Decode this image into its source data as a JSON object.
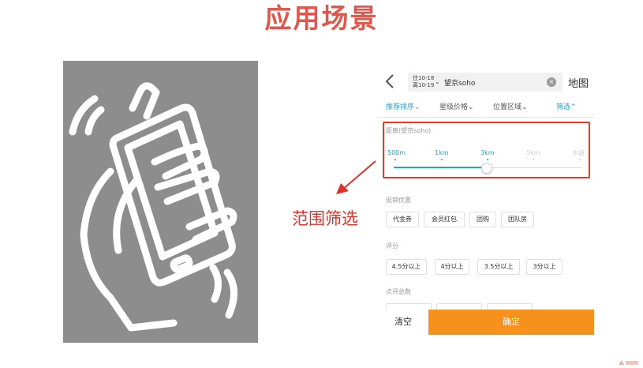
{
  "slide": {
    "title": "应用场景",
    "annotation": "范围筛选"
  },
  "phone_ui": {
    "back_icon": "chevron-left-icon",
    "dates": {
      "checkin": "住10-18",
      "checkout": "离10-19"
    },
    "keyword": "望京soho",
    "map_label": "地图",
    "tabs": [
      {
        "label": "推荐排序",
        "arrow": "⌄",
        "active": true
      },
      {
        "label": "星级价格",
        "arrow": "⌄",
        "active": false
      },
      {
        "label": "位置区域",
        "arrow": "⌄",
        "active": false
      },
      {
        "label": "筛选",
        "arrow": "⌃",
        "active": true
      }
    ],
    "distance": {
      "title": "距离(望京soho)",
      "options": [
        "500m",
        "1km",
        "3km",
        "5km",
        "不限"
      ],
      "selected_index": 2
    },
    "promo": {
      "title": "促销优惠",
      "chips": [
        "代金券",
        "会员红包",
        "团购",
        "团队房"
      ]
    },
    "rating": {
      "title": "评分",
      "chips": [
        "4.5分以上",
        "4分以上",
        "3.5分以上",
        "3分以上"
      ]
    },
    "reviews": {
      "title": "点评总数"
    },
    "footer": {
      "clear": "清空",
      "confirm": "确定"
    }
  },
  "colors": {
    "accent_blue": "#1fa3d8",
    "highlight_red": "#e53b2c",
    "title_red": "#e2564b",
    "confirm_orange": "#f7911e"
  }
}
